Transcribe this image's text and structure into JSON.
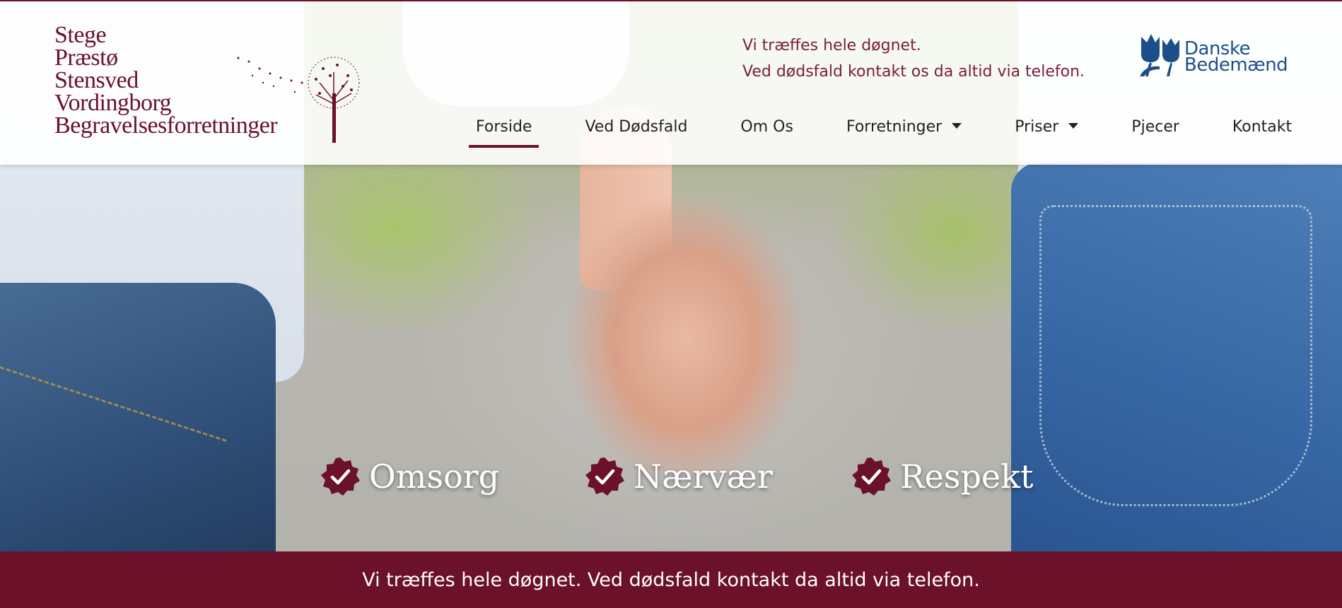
{
  "header": {
    "logo_lines": [
      "Stege",
      "Præstø",
      "Stensved",
      "Vordingborg",
      "Begravelsesforretninger"
    ],
    "contact_line_1": "Vi træffes hele døgnet.",
    "contact_line_2": "Ved dødsfald kontakt os da altid via telefon.",
    "partner_logo": {
      "line1": "Danske",
      "line2": "Bedemænd",
      "icon": "tulip-icon"
    }
  },
  "nav": {
    "items": [
      {
        "label": "Forside",
        "active": true
      },
      {
        "label": "Ved Dødsfald"
      },
      {
        "label": "Om Os"
      },
      {
        "label": "Forretninger",
        "dropdown": true
      },
      {
        "label": "Priser",
        "dropdown": true
      },
      {
        "label": "Pjecer"
      },
      {
        "label": "Kontakt"
      }
    ]
  },
  "hero": {
    "image": "holding-hands-photo",
    "values": [
      {
        "label": "Omsorg",
        "icon": "check-badge-icon"
      },
      {
        "label": "Nærvær",
        "icon": "check-badge-icon"
      },
      {
        "label": "Respekt",
        "icon": "check-badge-icon"
      }
    ]
  },
  "banner": {
    "text": "Vi træffes hele døgnet. Ved dødsfald kontakt da altid via telefon."
  },
  "colors": {
    "brand": "#6b1129",
    "partner_blue": "#1c4f8a"
  }
}
